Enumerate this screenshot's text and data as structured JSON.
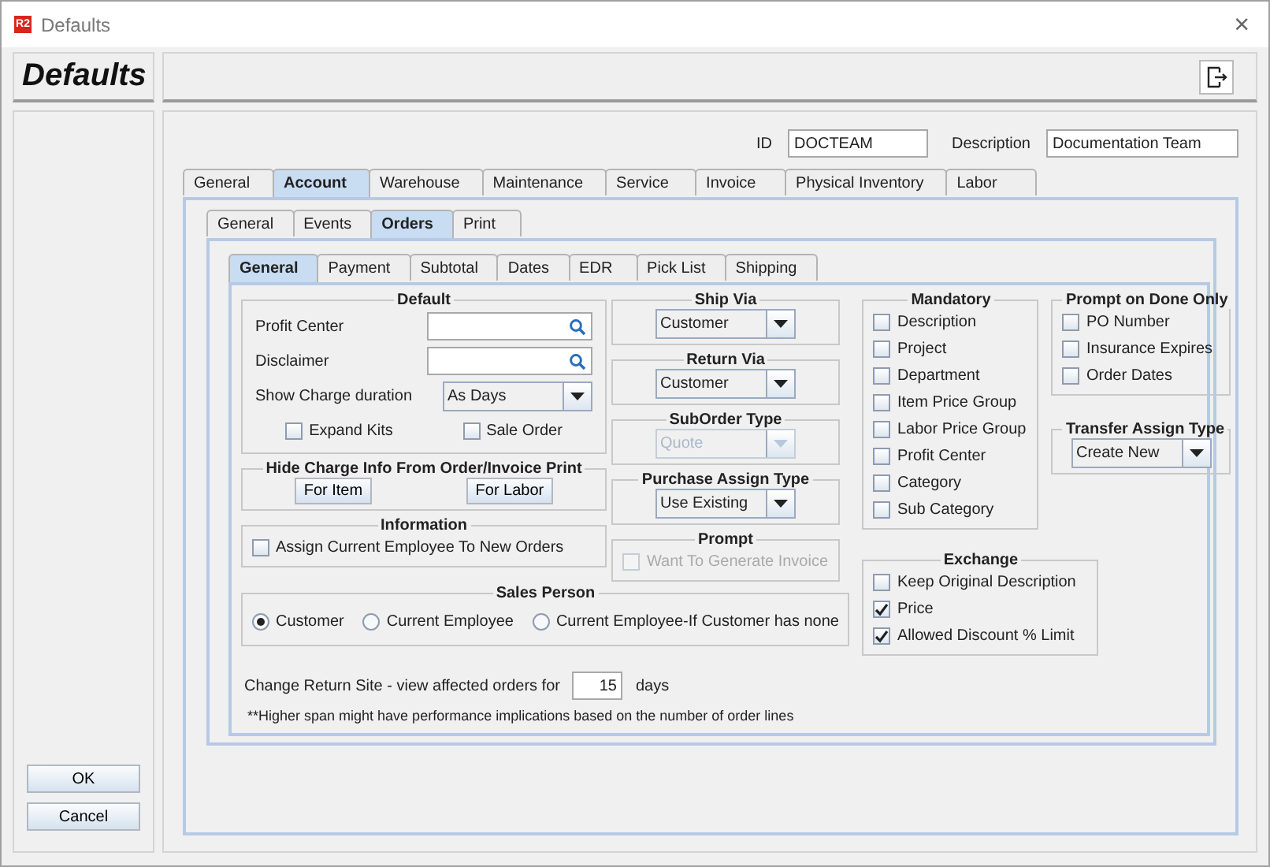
{
  "window": {
    "app_icon": "R2",
    "title": "Defaults",
    "close": "×"
  },
  "header": {
    "title": "Defaults"
  },
  "record": {
    "id_label": "ID",
    "id_value": "DOCTEAM",
    "description_label": "Description",
    "description_value": "Documentation Team"
  },
  "tabs": [
    {
      "label": "General",
      "selected": false
    },
    {
      "label": "Account",
      "selected": true
    },
    {
      "label": "Warehouse",
      "selected": false
    },
    {
      "label": "Maintenance",
      "selected": false
    },
    {
      "label": "Service",
      "selected": false
    },
    {
      "label": "Invoice",
      "selected": false
    },
    {
      "label": "Physical Inventory",
      "selected": false
    },
    {
      "label": "Labor",
      "selected": false
    }
  ],
  "sub_tabs": [
    {
      "label": "General",
      "selected": false
    },
    {
      "label": "Events",
      "selected": false
    },
    {
      "label": "Orders",
      "selected": true
    },
    {
      "label": "Print",
      "selected": false
    }
  ],
  "order_tabs": [
    {
      "label": "General",
      "selected": true
    },
    {
      "label": "Payment",
      "selected": false
    },
    {
      "label": "Subtotal",
      "selected": false
    },
    {
      "label": "Dates",
      "selected": false
    },
    {
      "label": "EDR",
      "selected": false
    },
    {
      "label": "Pick List",
      "selected": false
    },
    {
      "label": "Shipping",
      "selected": false
    }
  ],
  "left_columns": [
    [
      {
        "title": "Default",
        "rows": [
          [
            {
              "kind": "lookup",
              "label": "Profit Center"
            }
          ],
          [
            {
              "kind": "lookup",
              "label": "Disclaimer"
            }
          ],
          [
            {
              "kind": "dropdown",
              "label": "Show Charge duration",
              "value": "As Days",
              "disabled": false
            }
          ],
          [
            {
              "kind": "checkbox",
              "label": "Expand Kits",
              "checked": false,
              "disabled": false
            },
            {
              "kind": "checkbox",
              "label": "Sale Order",
              "checked": false,
              "disabled": false
            }
          ]
        ]
      },
      {
        "title": "Hide Charge Info From Order/Invoice Print",
        "rows": [
          [
            {
              "kind": "button",
              "label": "For Item"
            },
            {
              "kind": "button",
              "label": "For Labor"
            }
          ]
        ]
      },
      {
        "title": "Information",
        "rows": [
          [
            {
              "kind": "checkbox",
              "label": "Assign Current Employee To New Orders",
              "checked": false,
              "disabled": false
            }
          ]
        ]
      }
    ],
    [
      {
        "title": "Ship Via",
        "rows": [
          [
            {
              "kind": "dropdown",
              "value": "Customer",
              "disabled": false
            }
          ]
        ]
      },
      {
        "title": "Return Via",
        "rows": [
          [
            {
              "kind": "dropdown",
              "value": "Customer",
              "disabled": false
            }
          ]
        ]
      },
      {
        "title": "SubOrder Type",
        "rows": [
          [
            {
              "kind": "dropdown",
              "value": "Quote",
              "disabled": true
            }
          ]
        ]
      },
      {
        "title": "Purchase Assign Type",
        "rows": [
          [
            {
              "kind": "dropdown",
              "value": "Use Existing",
              "disabled": false
            }
          ]
        ]
      },
      {
        "title": "Prompt",
        "rows": [
          [
            {
              "kind": "checkbox",
              "label": "Want To Generate Invoice",
              "checked": false,
              "disabled": true
            }
          ]
        ]
      }
    ]
  ],
  "sales_person": {
    "title": "Sales Person",
    "rows": [
      [
        {
          "kind": "radio",
          "label": "Customer",
          "selected": true
        },
        {
          "kind": "radio",
          "label": "Current Employee",
          "selected": false
        },
        {
          "kind": "radio",
          "label": "Current Employee-If Customer has none",
          "selected": false
        }
      ]
    ]
  },
  "right_columns": [
    [
      {
        "title": "Mandatory",
        "rows": [
          [
            {
              "kind": "checkbox",
              "label": "Description",
              "checked": false,
              "disabled": false
            }
          ],
          [
            {
              "kind": "checkbox",
              "label": "Project",
              "checked": false,
              "disabled": false
            }
          ],
          [
            {
              "kind": "checkbox",
              "label": "Department",
              "checked": false,
              "disabled": false
            }
          ],
          [
            {
              "kind": "checkbox",
              "label": "Item Price Group",
              "checked": false,
              "disabled": false
            }
          ],
          [
            {
              "kind": "checkbox",
              "label": "Labor Price Group",
              "checked": false,
              "disabled": false
            }
          ],
          [
            {
              "kind": "checkbox",
              "label": "Profit Center",
              "checked": false,
              "disabled": false
            }
          ],
          [
            {
              "kind": "checkbox",
              "label": "Category",
              "checked": false,
              "disabled": false
            }
          ],
          [
            {
              "kind": "checkbox",
              "label": "Sub Category",
              "checked": false,
              "disabled": false
            }
          ]
        ]
      },
      {
        "title": "Exchange",
        "rows": [
          [
            {
              "kind": "checkbox",
              "label": "Keep Original Description",
              "checked": false,
              "disabled": false
            }
          ],
          [
            {
              "kind": "checkbox",
              "label": "Price",
              "checked": true,
              "disabled": false
            }
          ],
          [
            {
              "kind": "checkbox",
              "label": "Allowed Discount % Limit",
              "checked": true,
              "disabled": false
            }
          ]
        ]
      }
    ],
    [
      {
        "title": "Prompt on Done Only",
        "rows": [
          [
            {
              "kind": "checkbox",
              "label": "PO Number",
              "checked": false,
              "disabled": false
            }
          ],
          [
            {
              "kind": "checkbox",
              "label": "Insurance Expires",
              "checked": false,
              "disabled": false
            }
          ],
          [
            {
              "kind": "checkbox",
              "label": "Order Dates",
              "checked": false,
              "disabled": false
            }
          ]
        ]
      },
      {
        "title": "Transfer Assign Type",
        "rows": [
          [
            {
              "kind": "dropdown",
              "value": "Create New",
              "disabled": false
            }
          ]
        ]
      }
    ]
  ],
  "return_site": {
    "label": "Change Return Site - view affected orders for",
    "value": "15",
    "unit": "days"
  },
  "note": "**Higher span might have performance implications based on the number of order lines",
  "buttons": [
    {
      "label": "OK"
    },
    {
      "label": "Cancel"
    }
  ]
}
